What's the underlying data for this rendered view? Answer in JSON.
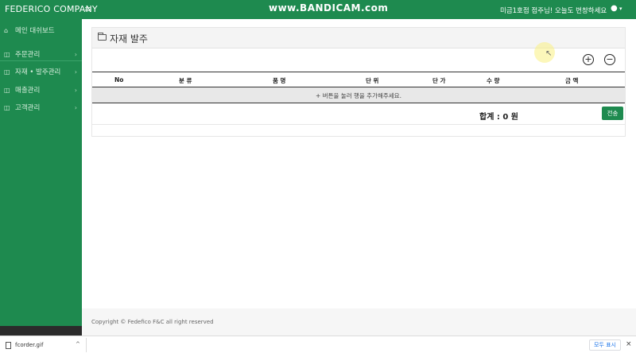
{
  "header": {
    "brand": "FEDERICO COMPANY",
    "menu_icon": "≡",
    "watermark": "www.BANDICAM.com",
    "greeting": "미금1호점 점주님! 오늘도 번창하세요",
    "user_icon": "user-icon",
    "caret": "▾"
  },
  "sidebar": {
    "dashboard": "메인 대쉬보드",
    "items": [
      {
        "label": "주문관리",
        "chevron": "›"
      },
      {
        "label": "자재 • 발주관리",
        "chevron": "›"
      },
      {
        "label": "매출관리",
        "chevron": "›"
      },
      {
        "label": "고객관리",
        "chevron": "›"
      }
    ]
  },
  "page": {
    "title": "자재 발주",
    "add_symbol": "+",
    "remove_symbol": "−",
    "columns": [
      "No",
      "분 류",
      "품 명",
      "단 위",
      "단 가",
      "수 량",
      "금 액"
    ],
    "empty_message": "+ 버튼을 눌러 행을 추가해주세요.",
    "total_label": "합계 : 0 원",
    "send_label": "전송"
  },
  "footer": {
    "copyright": "Copyright © Fedefico F&C all right reserved"
  },
  "download_bar": {
    "file_name": "fcorder.gif",
    "caret": "^",
    "show_all": "모두 표시",
    "close": "×"
  },
  "colors": {
    "primary": "#1e8a4f",
    "sidebar_bottom": "#2b2b2b"
  }
}
